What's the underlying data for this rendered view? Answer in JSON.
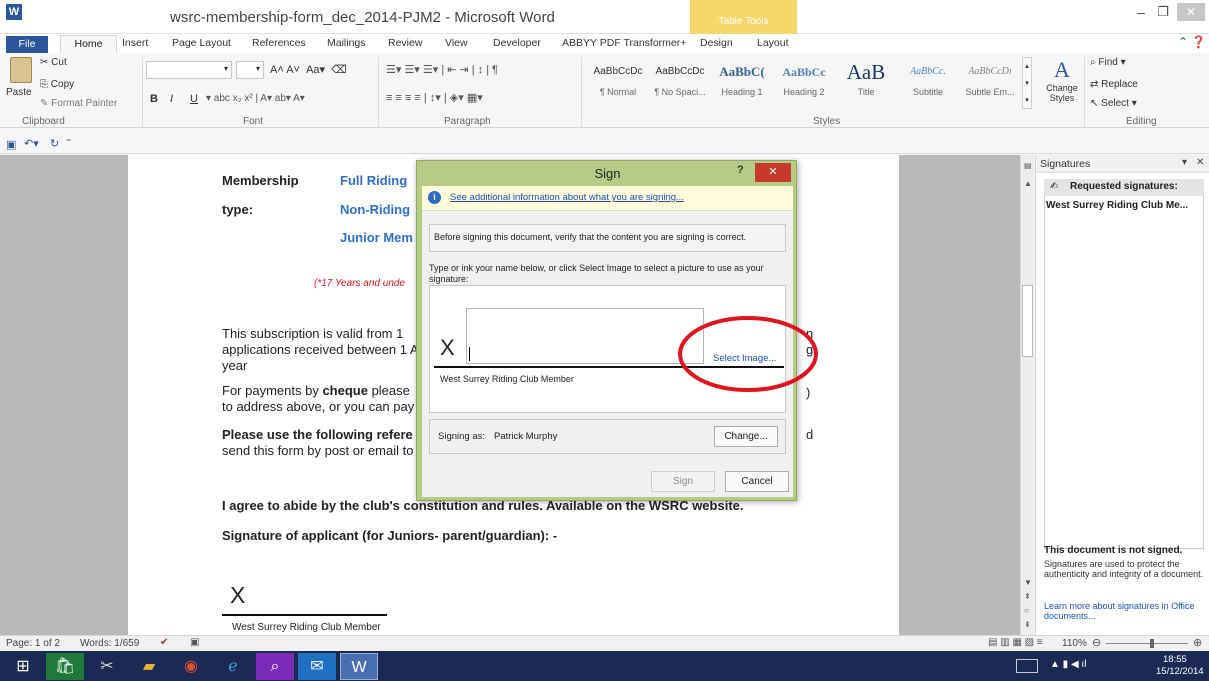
{
  "window": {
    "title": "wsrc-membership-form_dec_2014-PJM2 - Microsoft Word",
    "app_icon": "W",
    "context_tab_group": "Table Tools",
    "controls": {
      "minimize": "–",
      "maximize": "❐",
      "close": "✕"
    }
  },
  "tabs": [
    "File",
    "Home",
    "Insert",
    "Page Layout",
    "References",
    "Mailings",
    "Review",
    "View",
    "Developer",
    "ABBYY PDF Transformer+",
    "Design",
    "Layout"
  ],
  "ribbon": {
    "clipboard": {
      "paste": "Paste",
      "cut": "Cut",
      "copy": "Copy",
      "format_painter": "Format Painter",
      "group": "Clipboard"
    },
    "font": {
      "group": "Font",
      "bold": "B",
      "italic": "I",
      "underline": "U"
    },
    "paragraph": {
      "group": "Paragraph"
    },
    "styles": {
      "group": "Styles",
      "items": [
        {
          "sample": "AaBbCcDc",
          "name": "¶ Normal"
        },
        {
          "sample": "AaBbCcDc",
          "name": "¶ No Spaci..."
        },
        {
          "sample": "AaBbC(",
          "name": "Heading 1"
        },
        {
          "sample": "AaBbCc",
          "name": "Heading 2"
        },
        {
          "sample": "AaB",
          "name": "Title"
        },
        {
          "sample": "AaBbCc.",
          "name": "Subtitle"
        },
        {
          "sample": "AaBbCcDı",
          "name": "Subtle Em..."
        }
      ],
      "change_styles": "Change Styles"
    },
    "editing": {
      "group": "Editing",
      "find": "Find",
      "replace": "Replace",
      "select": "Select"
    }
  },
  "document": {
    "membership_label": "Membership",
    "type_label": "type:",
    "full_riding": "Full Riding",
    "non_riding": "Non-Riding",
    "junior": "Junior Mem",
    "under_note": "(*17 Years and unde",
    "para1_line1": "This subscription is valid from 1",
    "para1_line2": "applications received between 1 A",
    "para1_line3": "year",
    "para1_right_n": "n",
    "para1_right_g": "g",
    "para2_line1_a": "For payments by ",
    "para2_line1_b": "cheque",
    "para2_line1_c": " please",
    "para2_line2": "to address above, or  you can pay",
    "para2_right": ")",
    "para3_line1": "Please use the following refere",
    "para3_line2": "send this form by post or email to",
    "para3_right": "d",
    "agree": "I agree to abide by the club's constitution and rules. Available  on the WSRC website.",
    "signature_label": "Signature of applicant (for Juniors- parent/guardian): -",
    "sig_x": "X",
    "sig_caption": "West Surrey Riding Club Member"
  },
  "dialog": {
    "title": "Sign",
    "help": "?",
    "close": "✕",
    "info_link": "See additional information about what you are signing...",
    "verify_text": "Before signing this document, verify that the content you are signing is correct.",
    "instruction": "Type or ink your name below, or click Select Image to select a picture to use as your signature:",
    "x_mark": "X",
    "select_image": "Select Image...",
    "signer_caption": "West Surrey Riding Club Member",
    "signing_as_label": "Signing as:",
    "signer_name": "Patrick Murphy",
    "change_button": "Change...",
    "sign_button": "Sign",
    "cancel_button": "Cancel"
  },
  "signatures_pane": {
    "title": "Signatures",
    "requested_heading": "Requested signatures:",
    "requested_item": "West Surrey Riding Club Me...",
    "not_signed": "This document is not signed.",
    "description": "Signatures are used to protect the authenticity and integrity of a document.",
    "learn_more": "Learn more about signatures in Office documents..."
  },
  "status": {
    "page": "Page: 1 of 2",
    "words": "Words: 1/659",
    "zoom": "110%"
  },
  "taskbar": {
    "time": "18:55",
    "date": "15/12/2014"
  },
  "colors": {
    "word_blue": "#2b579a",
    "dialog_frame": "#b5cc86",
    "annotation_red": "#e0141e",
    "link_blue": "#1a4fb5"
  }
}
